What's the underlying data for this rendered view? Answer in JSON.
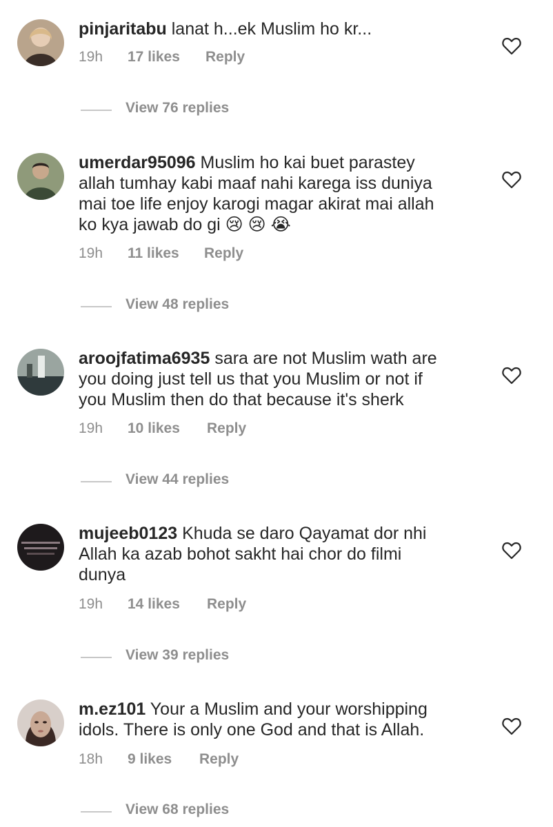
{
  "comments": [
    {
      "username": "pinjaritabu",
      "text": "lanat h...ek Muslim ho kr...",
      "time": "19h",
      "likes": "17 likes",
      "reply": "Reply",
      "view_replies": "View 76 replies",
      "avatar_colors": [
        "#b9a48c",
        "#3a2e28"
      ]
    },
    {
      "username": "umerdar95096",
      "text": "Muslim ho kai buet parastey\nallah tumhay kabi maaf nahi karega iss duniya\nmai toe life enjoy karogi magar akirat mai allah\nko kya jawab do gi 😢 😢 😭",
      "time": "19h",
      "likes": "11 likes",
      "reply": "Reply",
      "view_replies": "View 48 replies",
      "avatar_colors": [
        "#8f9a7a",
        "#3b4a36"
      ]
    },
    {
      "username": "aroojfatima6935",
      "text": "sara are not Muslim wath are\nyou doing just tell us that you Muslim or not if\nyou Muslim then do that because it's sherk",
      "time": "19h",
      "likes": "10 likes",
      "reply": "Reply",
      "view_replies": "View 44 replies",
      "avatar_colors": [
        "#9aa5a0",
        "#2f3a3c"
      ]
    },
    {
      "username": "mujeeb0123",
      "text": "Khuda se daro Qayamat dor nhi\nAllah ka azab bohot sakht hai chor do filmi\ndunya",
      "time": "19h",
      "likes": "14 likes",
      "reply": "Reply",
      "view_replies": "View 39 replies",
      "avatar_colors": [
        "#5a4c50",
        "#1e1a1c"
      ]
    },
    {
      "username": "m.ez101",
      "text": "Your a Muslim and your worshipping\nidols. There is only one God and that is Allah.",
      "time": "18h",
      "likes": "9 likes",
      "reply": "Reply",
      "view_replies": "View 68 replies",
      "avatar_colors": [
        "#c9a995",
        "#3a2824"
      ]
    }
  ]
}
